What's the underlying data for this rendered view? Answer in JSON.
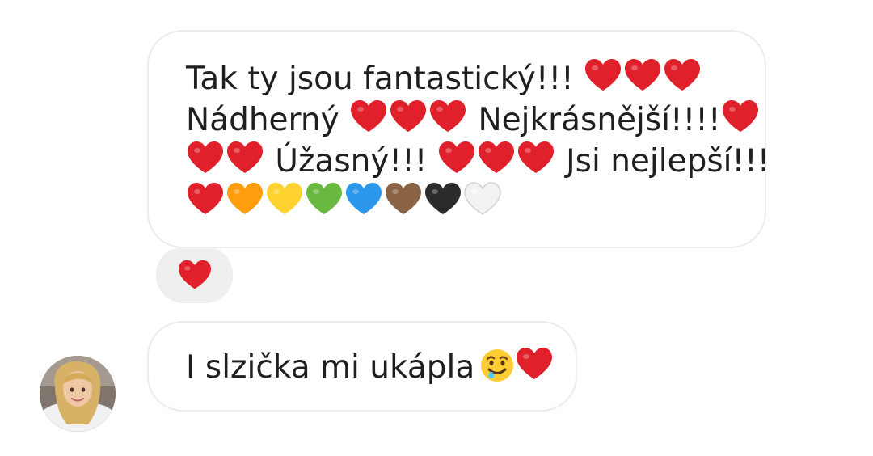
{
  "conversation": {
    "messages": [
      {
        "lines": [
          {
            "text": "Tak ty jsou fantastický!!!",
            "hearts": [
              "red",
              "red",
              "red"
            ]
          },
          {
            "text": "Nádherný",
            "hearts": [
              "red",
              "red",
              "red"
            ],
            "text2": " Nejkrásnější!!!!",
            "hearts2": [
              "red"
            ]
          },
          {
            "text": "",
            "hearts": [
              "red",
              "red"
            ],
            "text2": " Úžasný!!!",
            "hearts2": [
              "red",
              "red",
              "red"
            ],
            "text3": " Jsi nejlepší!!!"
          },
          {
            "hearts": [
              "red",
              "orange",
              "yellow",
              "green",
              "blue",
              "brown",
              "black",
              "white"
            ]
          }
        ],
        "reaction": "red heart"
      },
      {
        "text": "I slzička mi ukápla",
        "emoji": [
          "smiling-face-with-tear",
          "red heart"
        ]
      }
    ],
    "avatar": "user-avatar"
  },
  "colors": {
    "red": "#e0202a",
    "orange": "#ff9d0f",
    "yellow": "#ffd22f",
    "green": "#69b940",
    "blue": "#2b96ea",
    "brown": "#8a6244",
    "black": "#2b2b2b",
    "white": "#f2f2f2",
    "bubble_border": "#ececec",
    "reaction_bg": "#efefef",
    "text": "#1f1f1f"
  }
}
